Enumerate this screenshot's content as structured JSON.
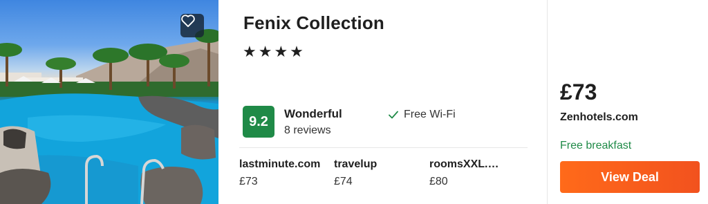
{
  "hotel": {
    "name": "Fenix Collection",
    "stars_text": "★★★★",
    "image_alt": "Hotel pool with palm trees",
    "favorite_icon": "heart-icon"
  },
  "rating": {
    "score": "9.2",
    "label": "Wonderful",
    "reviews": "8 reviews",
    "badge_color": "#1f8a47"
  },
  "amenity": {
    "icon": "check-icon",
    "label": "Free Wi-Fi"
  },
  "alt_deals": [
    {
      "provider": "lastminute.com",
      "price": "£73"
    },
    {
      "provider": "travelup",
      "price": "£74"
    },
    {
      "provider": "roomsXXL.com",
      "price": "£80"
    }
  ],
  "deal": {
    "price": "£73",
    "provider": "Zenhotels.com",
    "perk": "Free breakfast",
    "cta_label": "View Deal",
    "cta_color": "#ff6a1a",
    "perk_color": "#1f8a47"
  }
}
